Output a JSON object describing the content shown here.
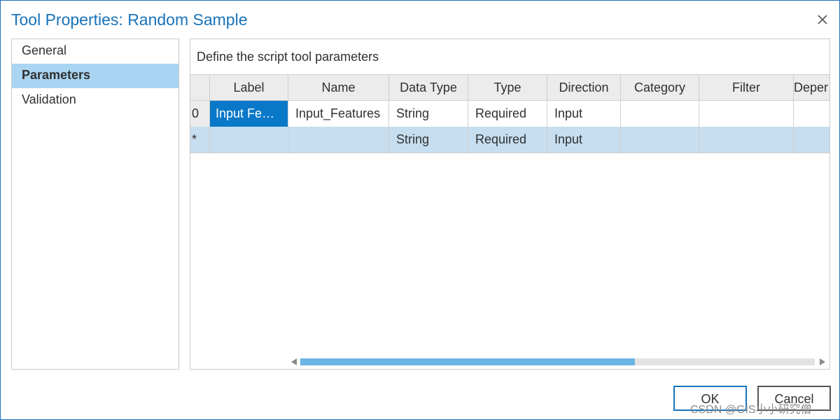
{
  "window": {
    "title": "Tool Properties: Random Sample",
    "close_icon": "close-icon"
  },
  "nav": {
    "items": [
      {
        "label": "General",
        "active": false
      },
      {
        "label": "Parameters",
        "active": true
      },
      {
        "label": "Validation",
        "active": false
      }
    ]
  },
  "panel": {
    "description": "Define the script tool parameters"
  },
  "grid": {
    "columns": [
      "Label",
      "Name",
      "Data Type",
      "Type",
      "Direction",
      "Category",
      "Filter",
      "Deper"
    ],
    "rows": [
      {
        "index": "0",
        "label": "Input Fe…",
        "name": "Input_Features",
        "data_type": "String",
        "type": "Required",
        "direction": "Input",
        "category": "",
        "filter": "",
        "dependency": ""
      },
      {
        "index": "*",
        "label": "",
        "name": "",
        "data_type": "String",
        "type": "Required",
        "direction": "Input",
        "category": "",
        "filter": "",
        "dependency": ""
      }
    ],
    "scroll": {
      "thumb_fraction": 0.65
    }
  },
  "buttons": {
    "ok": "OK",
    "cancel": "Cancel"
  },
  "watermark": "CSDN @GIS小小研究僧",
  "colors": {
    "accent": "#1873b9",
    "selection": "#0a78c8",
    "nav_active": "#a9d5f2",
    "new_row": "#c6def0"
  }
}
